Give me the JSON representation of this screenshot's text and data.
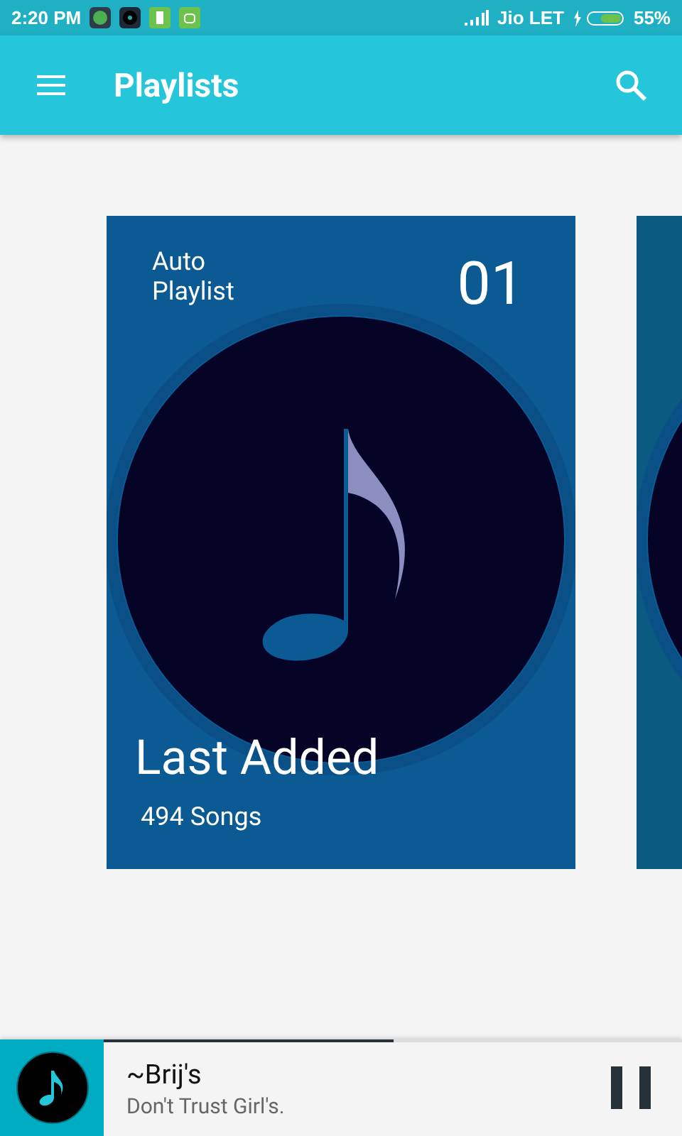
{
  "status_bar": {
    "time": "2:20 PM",
    "carrier": "Jio LET",
    "battery": "55%"
  },
  "app_bar": {
    "title": "Playlists"
  },
  "playlists": [
    {
      "label": "Auto Playlist",
      "number": "01",
      "title": "Last Added",
      "count": "494 Songs"
    },
    {
      "kind": "peek"
    }
  ],
  "now_playing": {
    "title": "~Brij's",
    "subtitle": "Don't Trust Girl's.",
    "level": 0.5,
    "playing": true
  }
}
